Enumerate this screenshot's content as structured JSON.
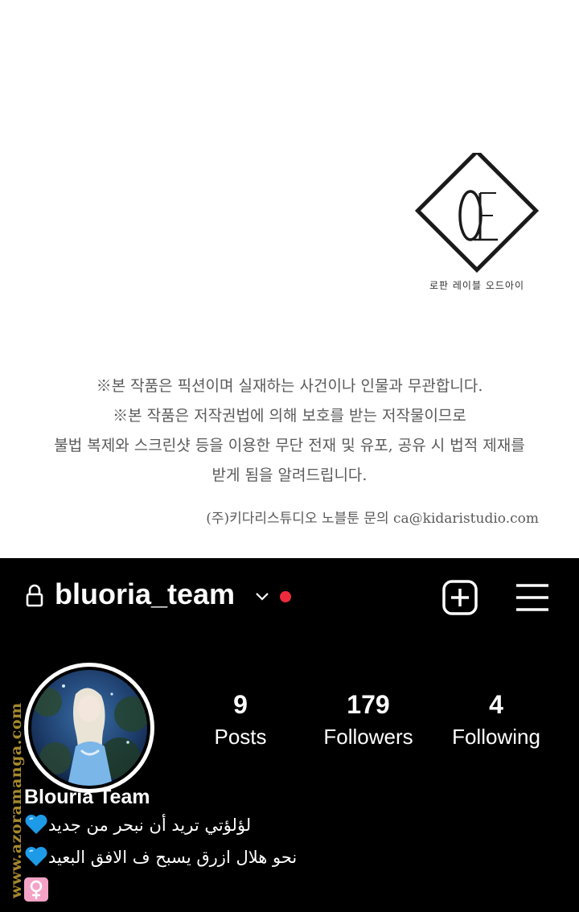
{
  "top_panel": {
    "logo_caption": "로판 레이블 오드아이",
    "notice_lines": [
      "※본 작품은 픽션이며 실재하는 사건이나 인물과 무관합니다.",
      "※본 작품은 저작권법에 의해 보호를 받는 저작물이므로",
      "불법 복제와 스크린샷 등을 이용한 무단 전재 및 유포, 공유 시 법적 제재를",
      "받게 됨을 알려드립니다."
    ],
    "contact": "(주)키다리스튜디오 노블툰 문의 ca@kidaristudio.com"
  },
  "profile": {
    "username": "bluoria_team",
    "notification_dot_color": "#ed2b3c",
    "icons": {
      "lock": "lock-icon",
      "chevron": "chevron-down-icon",
      "add": "add-post-icon",
      "menu": "hamburger-menu-icon"
    },
    "stats": {
      "posts": {
        "value": "9",
        "label": "Posts"
      },
      "followers": {
        "value": "179",
        "label": "Followers"
      },
      "following": {
        "value": "4",
        "label": "Following"
      }
    },
    "display_name": "Blouria Team",
    "bio": [
      "لؤلؤتي تريد أن نبحر من جديد",
      "نحو هلال ازرق يسبح ف الافق البعيد"
    ],
    "bio_emoji": [
      "blue-heart-icon",
      "female-sign-icon"
    ]
  },
  "watermark": "www.azoramanga.com"
}
